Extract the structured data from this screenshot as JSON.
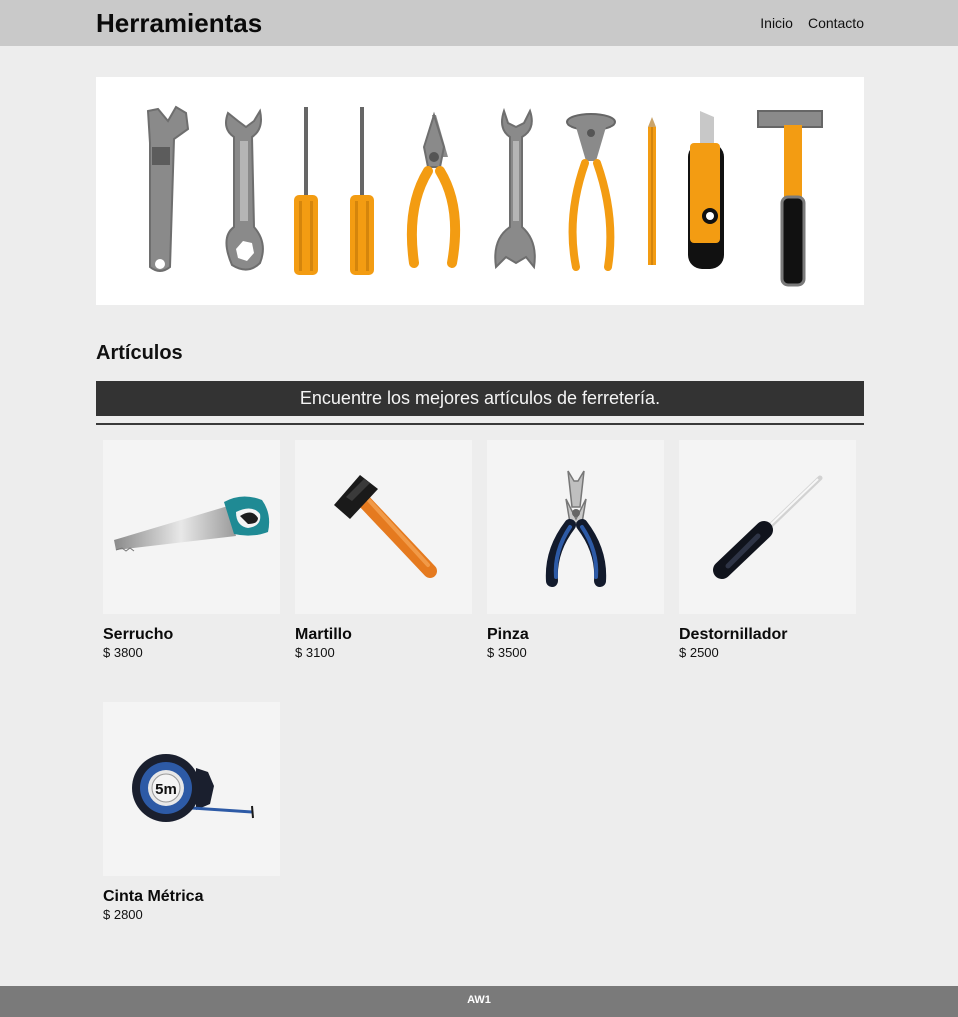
{
  "header": {
    "title": "Herramientas",
    "nav": [
      "Inicio",
      "Contacto"
    ]
  },
  "section": {
    "title": "Artículos",
    "banner": "Encuentre los mejores artículos de ferretería."
  },
  "products": [
    {
      "name": "Serrucho",
      "price": "$ 3800",
      "icon": "saw-icon"
    },
    {
      "name": "Martillo",
      "price": "$ 3100",
      "icon": "hammer-icon"
    },
    {
      "name": "Pinza",
      "price": "$ 3500",
      "icon": "pliers-icon"
    },
    {
      "name": "Destornillador",
      "price": "$ 2500",
      "icon": "screwdriver-icon"
    },
    {
      "name": "Cinta Métrica",
      "price": "$ 2800",
      "icon": "tape-measure-icon",
      "label": "5m"
    }
  ],
  "footer": {
    "text": "AW1"
  },
  "colors": {
    "topbar": "#c9c9c9",
    "page_bg": "#ededed",
    "banner_bg": "#333333",
    "footer_bg": "#7a7a7a",
    "tool_orange": "#f39c12",
    "tool_gray": "#8a8a8a"
  }
}
